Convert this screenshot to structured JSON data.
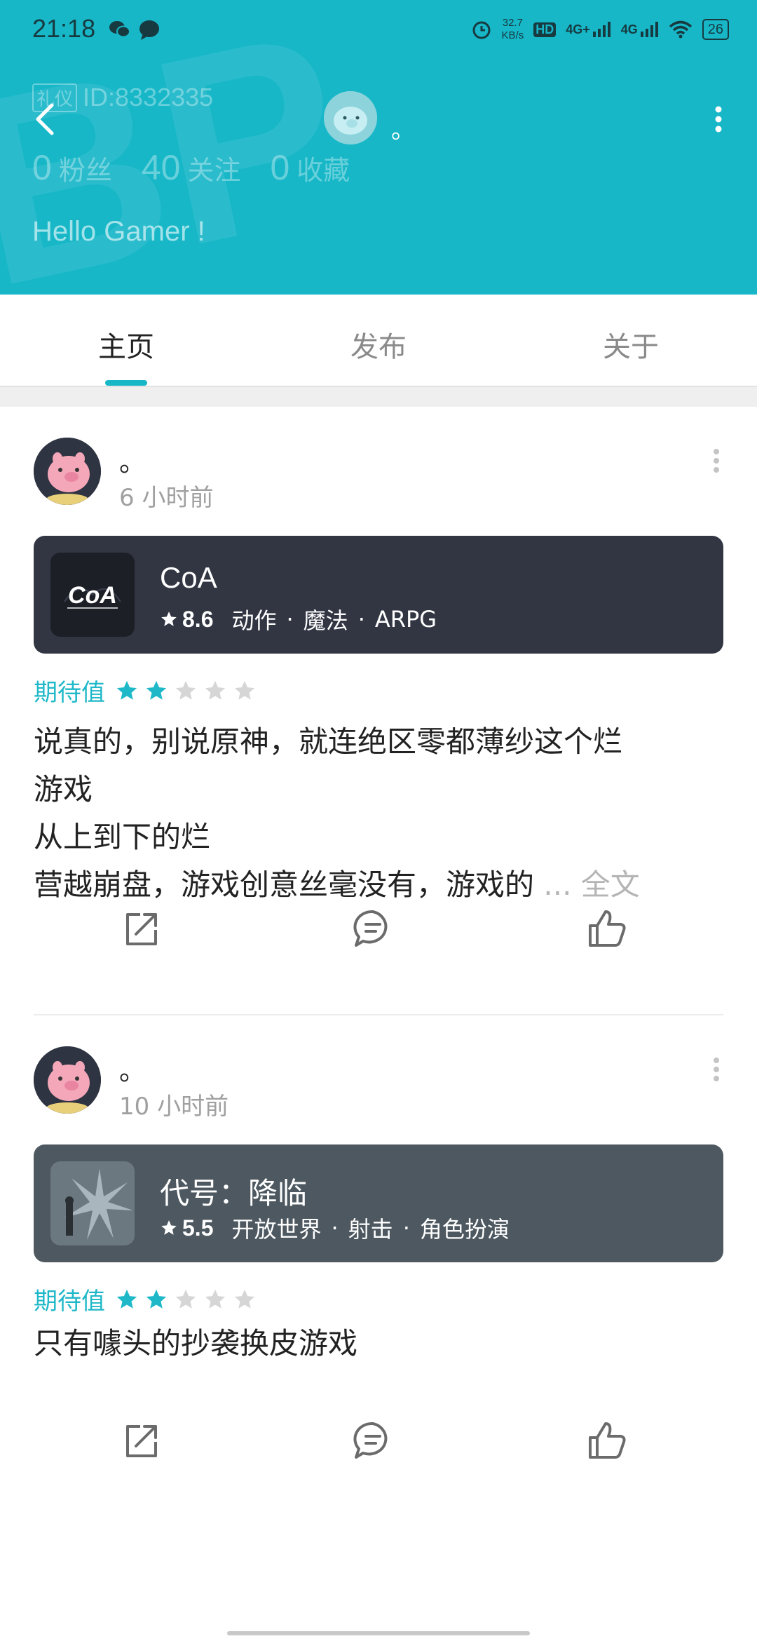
{
  "status_bar": {
    "time": "21:18",
    "net_speed_value": "32.7",
    "net_speed_unit": "KB/s",
    "hd": "HD",
    "sim1": "4G+",
    "sim2": "4G",
    "battery": "26"
  },
  "profile": {
    "name": "。",
    "id_badge": "礼仪",
    "id_text": "ID:8332335",
    "stats": [
      {
        "num": "0",
        "label": "粉丝"
      },
      {
        "num": "40",
        "label": "关注"
      },
      {
        "num": "0",
        "label": "收藏"
      }
    ],
    "bio": "Hello Gamer !"
  },
  "tabs": [
    {
      "label": "主页",
      "active": true
    },
    {
      "label": "发布",
      "active": false
    },
    {
      "label": "关于",
      "active": false
    }
  ],
  "posts": [
    {
      "author": "。",
      "time": "6 小时前",
      "game": {
        "title": "CoA",
        "score": "8.6",
        "tags": [
          "动作",
          "魔法",
          "ARPG"
        ],
        "card_color": "#323643"
      },
      "rating_label": "期待值",
      "rating": 2,
      "rating_max": 5,
      "body_lines": [
        "说真的，别说原神，就连绝区零都薄纱这个烂",
        "游戏",
        "从上到下的烂",
        "营越崩盘，游戏创意丝毫没有，游戏的"
      ],
      "ellipsis": "...",
      "read_more": "全文"
    },
    {
      "author": "。",
      "time": "10 小时前",
      "game": {
        "title": "代号：降临",
        "score": "5.5",
        "tags": [
          "开放世界",
          "射击",
          "角色扮演"
        ],
        "card_color": "#4d5860"
      },
      "rating_label": "期待值",
      "rating": 2,
      "rating_max": 5,
      "body_lines": [
        "只有噱头的抄袭换皮游戏"
      ]
    }
  ],
  "colors": {
    "accent": "#17b7c8",
    "star_on": "#1fb8c8",
    "star_off": "#d6d6d6"
  },
  "icons": [
    "back-arrow-icon",
    "more-vertical-icon",
    "share-icon",
    "comment-icon",
    "like-icon",
    "star-icon"
  ]
}
